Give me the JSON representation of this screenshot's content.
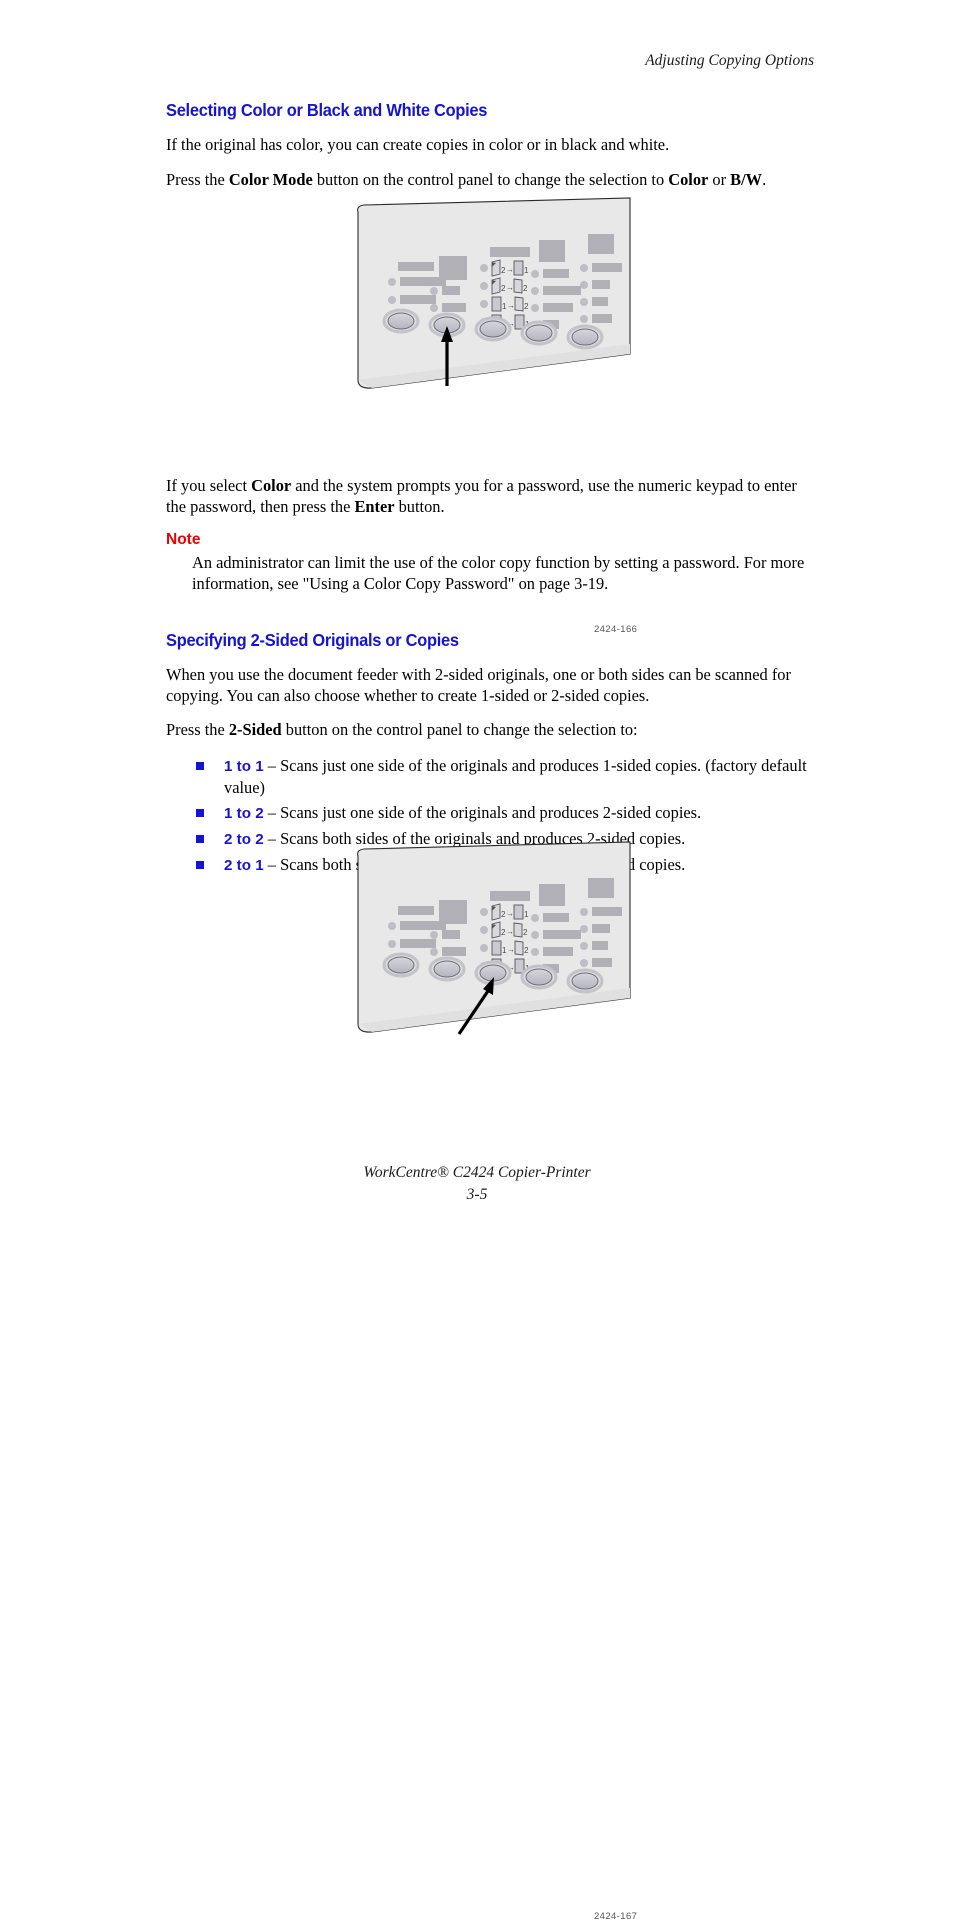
{
  "document": {
    "running_header": "Adjusting Copying Options",
    "footer_title": "WorkCentre® C2424 Copier-Printer",
    "footer_page": "3-5"
  },
  "section_color_copies": {
    "heading": "Selecting Color or Black and White Copies",
    "paragraph_1": "If the original has color, you can create copies in color or in black and white.",
    "paragraph_2_parts": {
      "a": "Press the ",
      "b1": "Color Mode",
      "c": " button on the control panel to change the selection to ",
      "b2": "Color",
      "d": " or ",
      "b3": "B/W",
      "e": "."
    },
    "paragraph_3_parts": {
      "a": "If you select ",
      "b1": "Color",
      "c": " and the system prompts you for a password, use the numeric keypad to enter the password, then press the ",
      "b2": "Enter",
      "d": " button."
    },
    "note_label": "Note",
    "note_text": "An administrator can limit the use of the color copy function by setting a password. For more information, see \"Using a Color Copy Password\" on page 3-19."
  },
  "section_two_sided": {
    "heading": "Specifying 2-Sided Originals or Copies",
    "paragraph_1": "When you use the document feeder with 2-sided originals, one or both sides can be scanned for copying. You can also choose whether to create 1-sided or 2-sided copies.",
    "paragraph_2_parts": {
      "a": "Press the ",
      "b1": "2-Sided",
      "c": " button on the control panel to change the selection to:"
    },
    "bullets": [
      {
        "term": "1 to 1",
        "text": " – Scans just one side of the originals and produces 1-sided copies. (factory default value)"
      },
      {
        "term": "1 to 2",
        "text": " – Scans just one side of the originals and produces 2-sided copies."
      },
      {
        "term": "2 to 2",
        "text": " – Scans both sides of the originals and produces 2-sided copies."
      },
      {
        "term": "2 to 1",
        "text": " – Scans both sides of the originals and produces 1-sided copies."
      }
    ]
  },
  "figures": [
    {
      "id": "figure-control-panel-color-mode",
      "caption": "2424-166",
      "callout_target_button_index": 2,
      "callout_style": "vertical-arrow",
      "two_sided_icon_labels": [
        "2 → 1",
        "2 → 2",
        "1 → 2",
        "1 → 1"
      ]
    },
    {
      "id": "figure-control-panel-two-sided",
      "caption": "2424-167",
      "callout_target_button_index": 3,
      "callout_style": "diagonal-arrow",
      "two_sided_icon_labels": [
        "2 → 1",
        "2 → 2",
        "1 → 2",
        "1 → 1"
      ]
    }
  ],
  "colors": {
    "heading_blue": "#1414d2",
    "note_red": "#ee0000",
    "panel_face": "#e8e8e8",
    "panel_label_gray": "#b0b0b6",
    "panel_button_fill": "#bcbcc4",
    "text_black": "#000000"
  }
}
